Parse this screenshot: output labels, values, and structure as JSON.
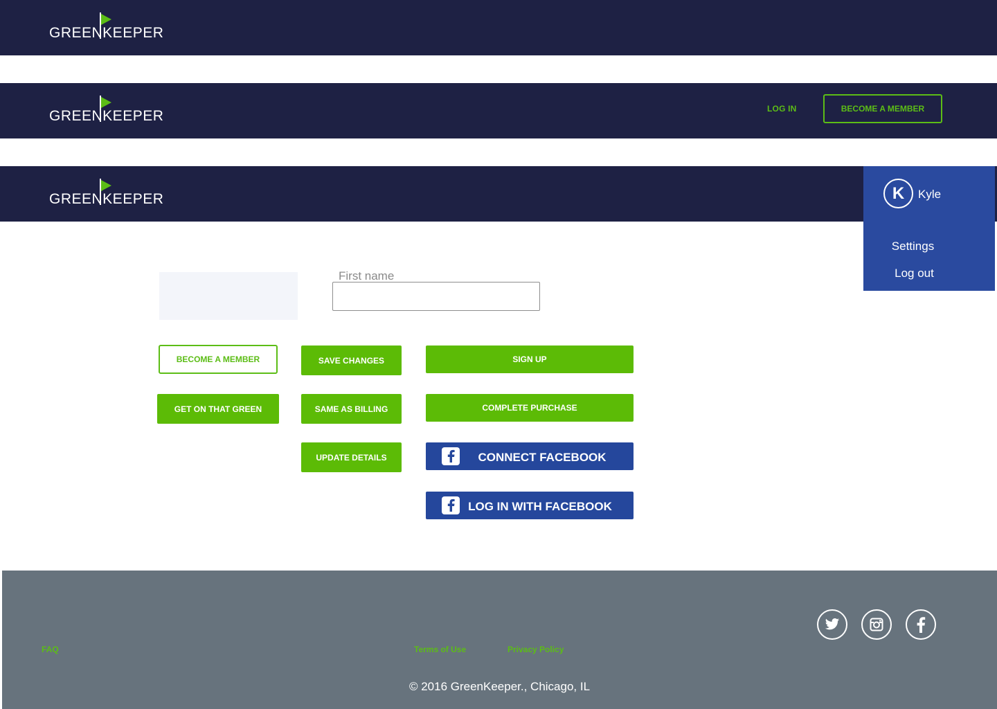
{
  "brand": {
    "name": "GREENKEEPER",
    "accent": "#5cbd16",
    "nav_bg": "#1e2144",
    "fb_blue": "#25479c"
  },
  "navbar_guest": {
    "login_label": "LOG IN",
    "become_member_label": "BECOME A MEMBER"
  },
  "user_menu": {
    "avatar_initial": "K",
    "username": "Kyle",
    "settings_label": "Settings",
    "logout_label": "Log out"
  },
  "form": {
    "first_name_label": "First name",
    "first_name_value": ""
  },
  "buttons": {
    "become_member": "BECOME A MEMBER",
    "save_changes": "SAVE CHANGES",
    "sign_up": "SIGN UP",
    "get_on_green": "GET ON THAT GREEN",
    "same_as_billing": "SAME AS BILLING",
    "complete_purchase": "COMPLETE PURCHASE",
    "update_details": "UPDATE DETAILS",
    "connect_facebook": "CONNECT FACEBOOK",
    "login_facebook": "LOG IN WITH FACEBOOK"
  },
  "footer": {
    "faq": "FAQ",
    "terms": "Terms of Use",
    "privacy": "Privacy Policy",
    "copyright": "© 2016 GreenKeeper., Chicago, IL",
    "social": [
      "twitter-icon",
      "instagram-icon",
      "facebook-icon"
    ]
  }
}
